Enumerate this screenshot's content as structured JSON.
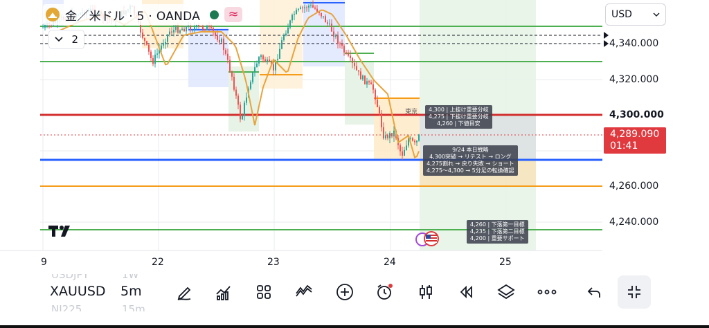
{
  "legend": {
    "symbol_title": "金／米ドル · 5 · OANDA",
    "wave_icon": "≈",
    "symbol_icon": "gold-coin-icon",
    "colors": {
      "symbol": "#e2a735",
      "status": "#1c7a52",
      "wave_bg": "#f8d9e1",
      "wave_fg": "#e0245e"
    }
  },
  "indicators": {
    "count": "2",
    "icon": "chevron-down-icon"
  },
  "currency": {
    "value": "USD",
    "icon": "chevron-down-icon"
  },
  "price_axis": {
    "labels": [
      "4,340.000",
      "4,320.000",
      "4,300.000",
      "4,260.000",
      "4,240.000"
    ],
    "emphasized": "4,300.000",
    "current_price": "4,289.090",
    "countdown": "01:41"
  },
  "time_axis": {
    "labels": [
      "9",
      "22",
      "23",
      "24",
      "25"
    ]
  },
  "annotations": {
    "levels_box": [
      "4,300 | 上抜け重要分岐",
      "4,275 | 下抜け重要分岐",
      "4,260 | 下値目安"
    ],
    "strategy_box": [
      "9/24 本日戦略",
      "4,300突破 → リテスト → ロング",
      "4,275割れ → 戻り失敗 → ショート",
      "4,275〜4,300 → 5分足の転換確認"
    ],
    "targets_box": [
      "4,260 | 下落第一目標",
      "4,235 | 下落第二目標",
      "4,200 | 重要サポート"
    ],
    "fragment": "東京"
  },
  "levels": {
    "4345": {
      "color": "#4caf50"
    },
    "4330": {
      "color": "#4caf50"
    },
    "4300": {
      "color": "#d32f2f"
    },
    "4275": {
      "color": "#2962ff"
    },
    "4260": {
      "color": "#f59c1a"
    },
    "4235": {
      "color": "#4caf50"
    }
  },
  "toolbar": {
    "symbol": "XAUUSD",
    "timeframe": "5m",
    "ghost_above": [
      "USDJPY",
      "1W"
    ],
    "ghost_below": [
      "NI225",
      "15m"
    ],
    "tools": [
      "pencil-draw-icon",
      "indicators-chart-icon",
      "grid-layout-icon",
      "pattern-tool-icon",
      "plus-circle-icon",
      "alarm-icon",
      "candles-icon",
      "replay-icon",
      "layers-icon",
      "more-icon",
      "undo-icon",
      "collapse-icon"
    ]
  },
  "colors": {
    "up": "#26a69a",
    "down": "#ef5350",
    "ma": "#e8a33c",
    "price_tag": "#e0393e",
    "strategy_zone": "#4caf50",
    "orange_zone": "#ffd28a",
    "blue_zone": "#c9d6ff"
  }
}
